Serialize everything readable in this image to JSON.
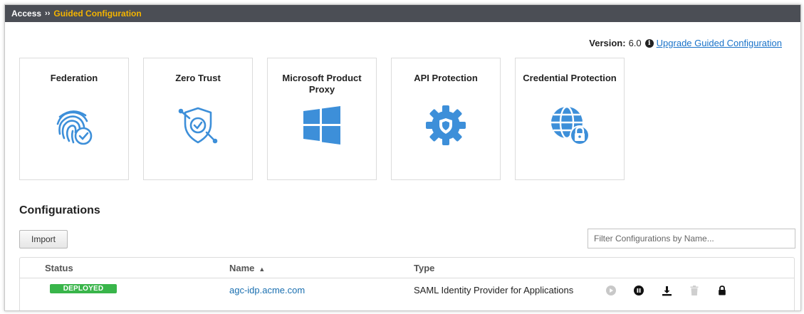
{
  "breadcrumb": {
    "root": "Access",
    "separator": "››",
    "current": "Guided Configuration"
  },
  "version": {
    "label": "Version:",
    "value": "6.0",
    "info_icon": "info-circle-icon",
    "upgrade_link": "Upgrade Guided Configuration"
  },
  "cards": [
    {
      "title": "Federation",
      "icon": "fingerprint-check-icon"
    },
    {
      "title": "Zero Trust",
      "icon": "shield-check-icon"
    },
    {
      "title": "Microsoft Product Proxy",
      "icon": "windows-logo-icon"
    },
    {
      "title": "API Protection",
      "icon": "gear-shield-icon"
    },
    {
      "title": "Credential Protection",
      "icon": "globe-lock-icon"
    }
  ],
  "configurations": {
    "title": "Configurations",
    "import_label": "Import",
    "filter_placeholder": "Filter Configurations by Name...",
    "columns": {
      "status": "Status",
      "name": "Name",
      "type": "Type"
    },
    "rows": [
      {
        "status": "DEPLOYED",
        "name": "agc-idp.acme.com",
        "type": "SAML Identity Provider for Applications",
        "actions": [
          "play-icon",
          "pause-icon",
          "download-icon",
          "trash-icon",
          "lock-icon"
        ]
      }
    ]
  },
  "colors": {
    "accent": "#1a73c9",
    "icon_blue": "#3d8fd9",
    "deployed_green": "#39b54a",
    "breadcrumb_current": "#f4b400",
    "header_bg": "#4b4e55"
  }
}
